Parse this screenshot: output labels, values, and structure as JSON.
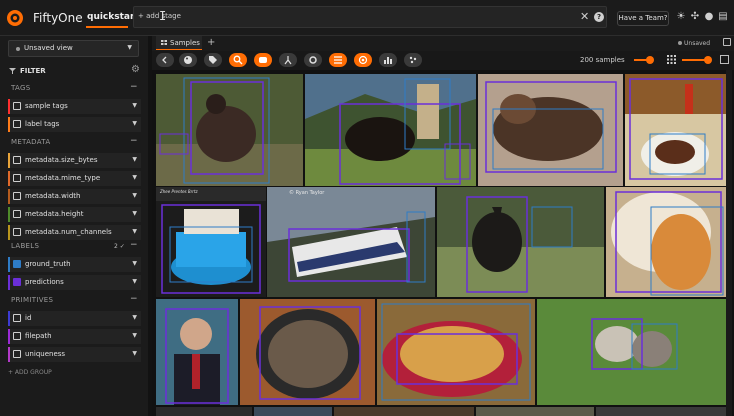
{
  "header": {
    "brand": "FiftyOne",
    "dataset": "quickstart",
    "add_stage": "+ add stage",
    "team_button": "Have a Team?",
    "icons": [
      "sun-icon",
      "slack-icon",
      "github-icon",
      "docs-icon"
    ]
  },
  "sidebar": {
    "view_select": "Unsaved view",
    "filter_title": "FILTER",
    "sections": {
      "tags": "TAGS",
      "metadata": "METADATA",
      "labels": "LABELS",
      "primitives": "PRIMITIVES"
    },
    "labels_count": "2 ✓",
    "tags": [
      {
        "label": "sample tags",
        "color": "#ff2f2f"
      },
      {
        "label": "label tags",
        "color": "#ff7c1a"
      }
    ],
    "metadata": [
      {
        "label": "metadata.size_bytes",
        "color": "#e8a43a"
      },
      {
        "label": "metadata.mime_type",
        "color": "#e06a2a"
      },
      {
        "label": "metadata.width",
        "color": "#b55c1e"
      },
      {
        "label": "metadata.height",
        "color": "#4f8b2a"
      },
      {
        "label": "metadata.num_channels",
        "color": "#b9961d"
      }
    ],
    "labels": [
      {
        "label": "ground_truth",
        "color": "#2e7cc7"
      },
      {
        "label": "predictions",
        "color": "#6b2fd9"
      }
    ],
    "primitives": [
      {
        "label": "id",
        "color": "#3d3bd4"
      },
      {
        "label": "filepath",
        "color": "#9b2ad6"
      },
      {
        "label": "uniqueness",
        "color": "#b33ac9"
      }
    ],
    "add_group": "+ ADD GROUP"
  },
  "main": {
    "tab_label": "Samples",
    "tab_add": "+",
    "unsaved": "Unsaved",
    "samples_count": "200 samples"
  },
  "tiles": {
    "train_caption": "© Ryan Taylor",
    "cake_caption": "Zhee Prentes Brrtz"
  },
  "colors": {
    "accent": "#ff6d04",
    "box": "#6b2fd9"
  }
}
